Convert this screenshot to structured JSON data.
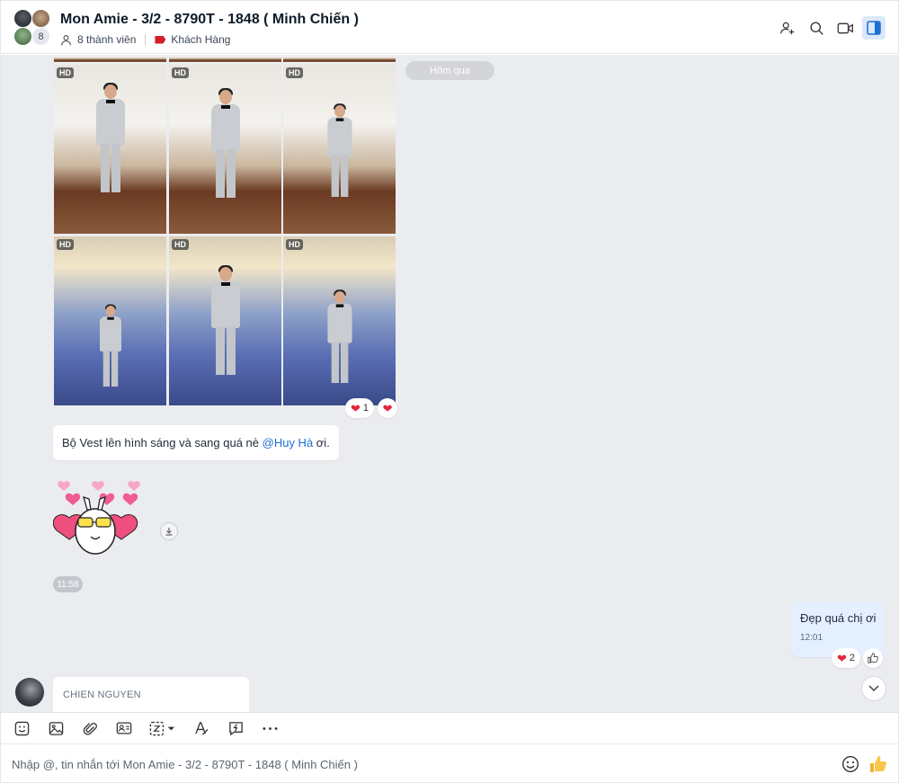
{
  "header": {
    "title": "Mon Amie - 3/2 - 8790T - 1848 ( Minh Chiến )",
    "member_count_badge": "8",
    "members_label": "8 thành viên",
    "tag_label": "Khách Hàng",
    "tag_color": "#d21f2d",
    "icons": [
      "add-member-icon",
      "search-icon",
      "video-call-icon",
      "sidebar-toggle-icon"
    ]
  },
  "chat": {
    "date_separator": "Hôm qua",
    "photo_badges": [
      "HD",
      "HD",
      "HD",
      "HD",
      "HD",
      "HD"
    ],
    "photo_reactions": {
      "heart_count": "1"
    },
    "message1": {
      "text_before": "Bộ Vest lên hình sáng và sang quá nè ",
      "mention": "@Huy Hà",
      "text_after": " ơi."
    },
    "sticker_time": "11:58",
    "my_message": {
      "text": "Đẹp quá chị ơi",
      "time": "12:01",
      "heart_count": "2"
    },
    "next_sender": "CHIEN NGUYEN"
  },
  "toolbar": {
    "icons": [
      "sticker-icon",
      "image-icon",
      "attach-icon",
      "contact-card-icon",
      "screenshot-icon",
      "format-text-icon",
      "quick-message-icon",
      "more-icon"
    ]
  },
  "input": {
    "placeholder": "Nhập @, tin nhắn tới Mon Amie - 3/2 - 8790T - 1848 ( Minh Chiến )"
  },
  "colors": {
    "accent": "#1a6fd1",
    "chat_bg": "#ebecf0",
    "my_bubble": "#e4efff",
    "heart": "#e0283a"
  }
}
